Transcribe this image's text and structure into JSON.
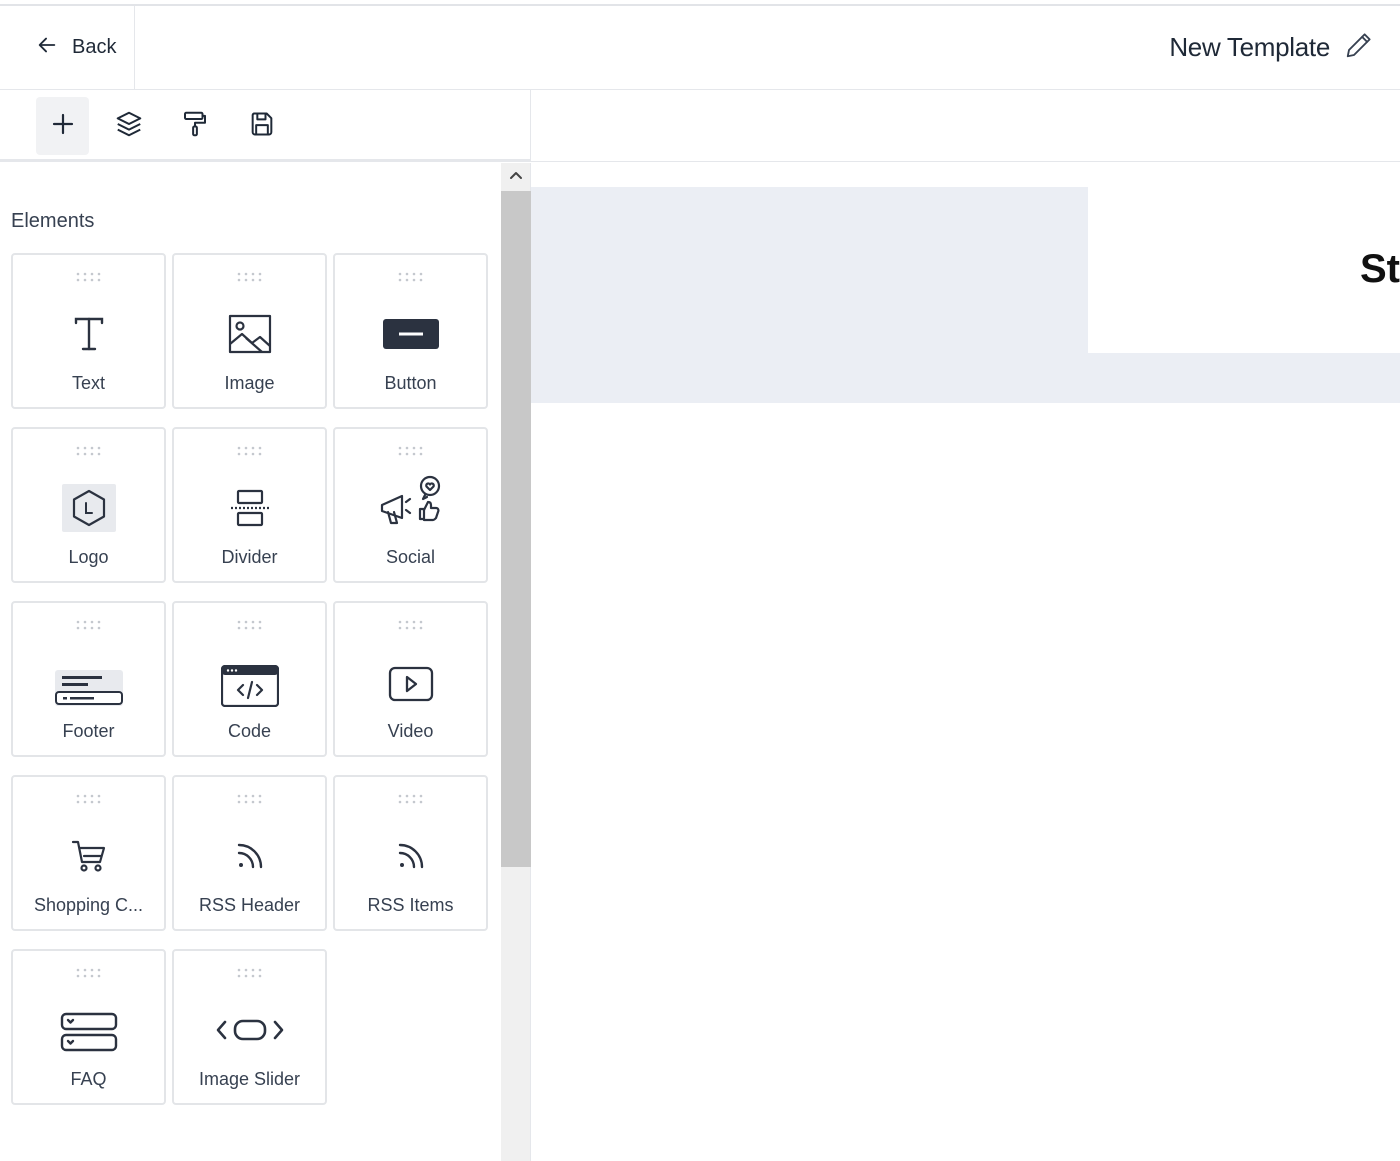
{
  "header": {
    "back_label": "Back",
    "template_title": "New Template"
  },
  "toolbar": {
    "tools": [
      {
        "name": "add-elements",
        "icon": "plus-icon",
        "active": true
      },
      {
        "name": "layers",
        "icon": "layers-icon",
        "active": false
      },
      {
        "name": "styles",
        "icon": "paint-roller-icon",
        "active": false
      },
      {
        "name": "save",
        "icon": "floppy-disk-icon",
        "active": false
      }
    ]
  },
  "sidebar": {
    "section_title": "Elements",
    "elements": [
      {
        "label": "Text",
        "icon": "text-icon"
      },
      {
        "label": "Image",
        "icon": "image-icon"
      },
      {
        "label": "Button",
        "icon": "button-icon"
      },
      {
        "label": "Logo",
        "icon": "logo-icon"
      },
      {
        "label": "Divider",
        "icon": "divider-icon"
      },
      {
        "label": "Social",
        "icon": "social-icon"
      },
      {
        "label": "Footer",
        "icon": "footer-icon"
      },
      {
        "label": "Code",
        "icon": "code-icon"
      },
      {
        "label": "Video",
        "icon": "video-icon"
      },
      {
        "label": "Shopping C...",
        "icon": "shopping-cart-icon"
      },
      {
        "label": "RSS Header",
        "icon": "rss-icon"
      },
      {
        "label": "RSS Items",
        "icon": "rss-icon"
      },
      {
        "label": "FAQ",
        "icon": "faq-icon"
      },
      {
        "label": "Image Slider",
        "icon": "image-slider-icon"
      }
    ]
  },
  "canvas": {
    "header_text_partial": "St"
  },
  "colors": {
    "text": "#1f2937",
    "icon_dark": "#2b3240",
    "canvas_band": "#ebeef4",
    "scrollbar_thumb": "#c8c8c8"
  }
}
